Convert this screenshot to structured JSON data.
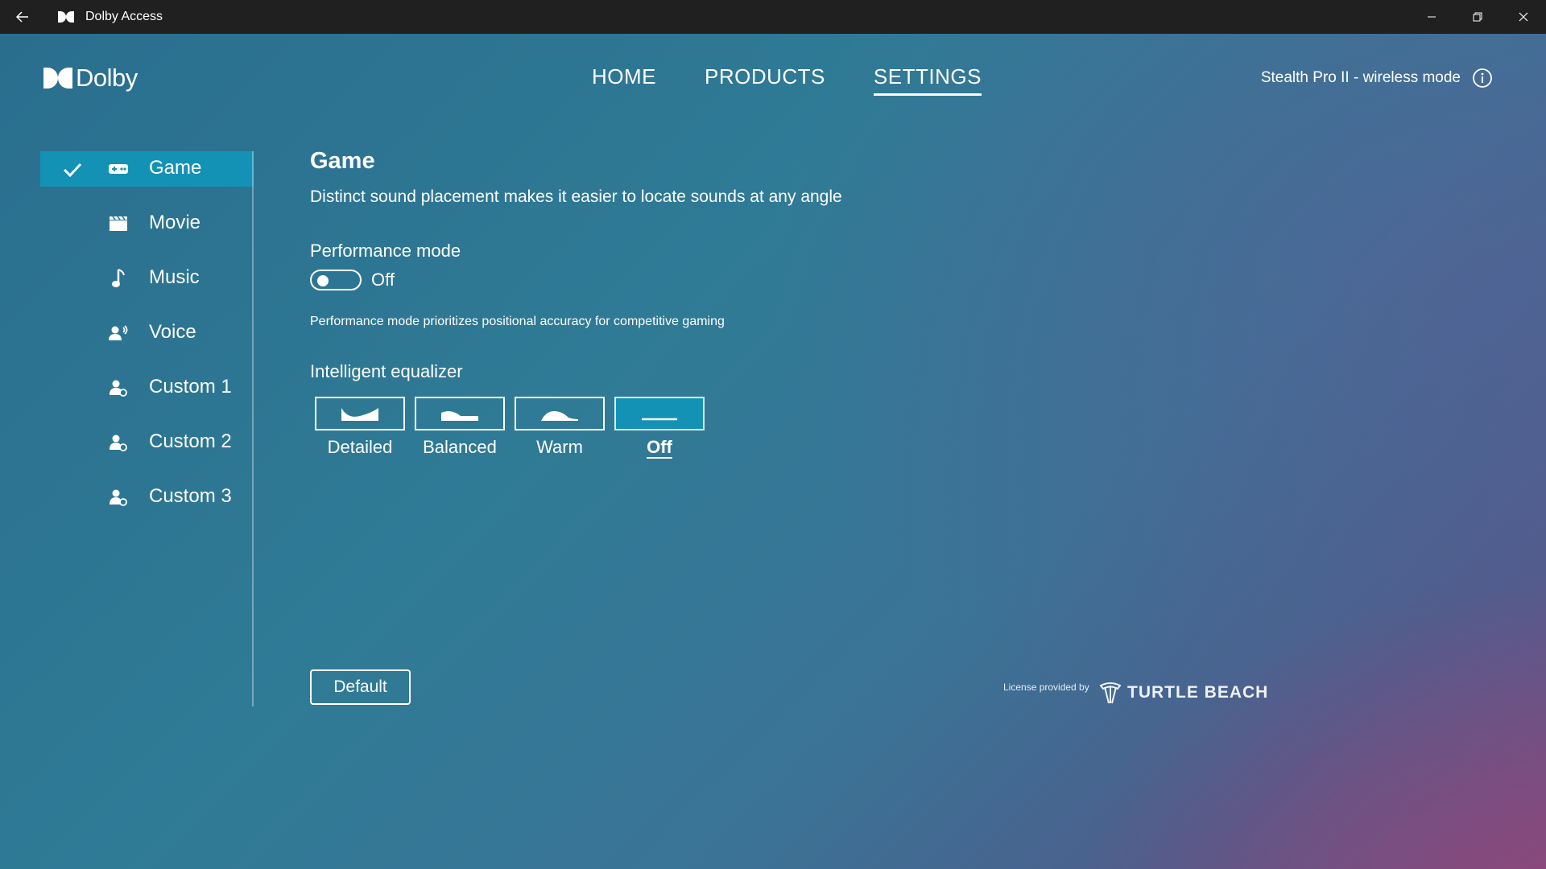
{
  "titlebar": {
    "title": "Dolby Access",
    "icons": [
      "back-arrow-icon",
      "dolby-app-icon",
      "minimize-icon",
      "restore-icon",
      "close-icon"
    ]
  },
  "header": {
    "logo_text": "Dolby",
    "nav": [
      {
        "label": "HOME",
        "active": false
      },
      {
        "label": "PRODUCTS",
        "active": false
      },
      {
        "label": "SETTINGS",
        "active": true
      }
    ],
    "device": "Stealth Pro II - wireless mode"
  },
  "sidebar": {
    "items": [
      {
        "label": "Game",
        "icon": "gamepad-icon",
        "active": true
      },
      {
        "label": "Movie",
        "icon": "clapperboard-icon",
        "active": false
      },
      {
        "label": "Music",
        "icon": "music-note-icon",
        "active": false
      },
      {
        "label": "Voice",
        "icon": "voice-user-icon",
        "active": false
      },
      {
        "label": "Custom 1",
        "icon": "custom-user-icon",
        "active": false
      },
      {
        "label": "Custom 2",
        "icon": "custom-user-icon",
        "active": false
      },
      {
        "label": "Custom 3",
        "icon": "custom-user-icon",
        "active": false
      }
    ]
  },
  "content": {
    "title": "Game",
    "description": "Distinct sound placement makes it easier to locate sounds at any angle",
    "performance_label": "Performance mode",
    "performance_state": "Off",
    "performance_note": "Performance mode prioritizes positional accuracy for competitive gaming",
    "eq_label": "Intelligent equalizer",
    "eq_options": [
      {
        "label": "Detailed",
        "selected": false,
        "icon": "eq-detailed-icon"
      },
      {
        "label": "Balanced",
        "selected": false,
        "icon": "eq-balanced-icon"
      },
      {
        "label": "Warm",
        "selected": false,
        "icon": "eq-warm-icon"
      },
      {
        "label": "Off",
        "selected": true,
        "icon": "eq-off-icon"
      }
    ],
    "default_button": "Default"
  },
  "footer": {
    "license_text": "License provided by",
    "brand": "TURTLE BEACH"
  },
  "colors": {
    "accent": "#1492b5",
    "titlebar": "#202020"
  }
}
